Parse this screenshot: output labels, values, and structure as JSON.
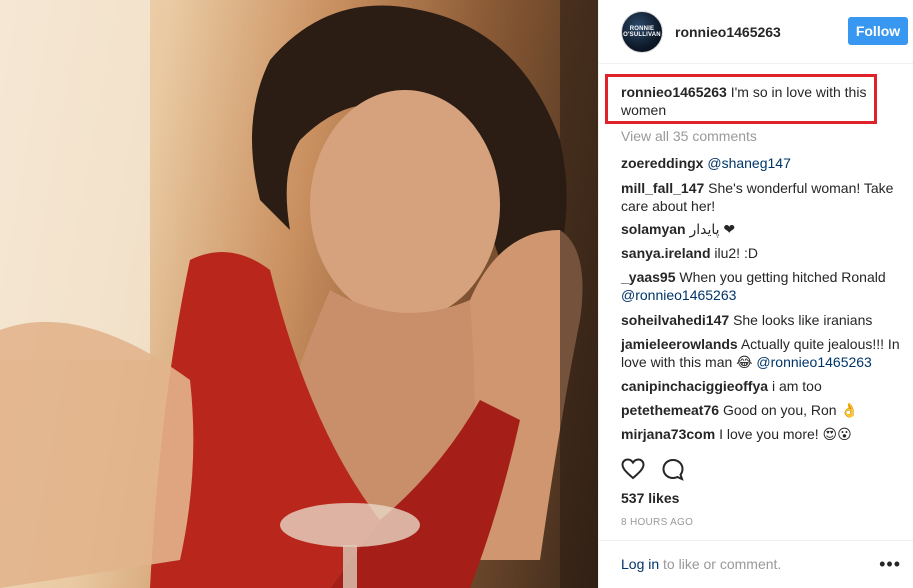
{
  "post": {
    "photo_label": "post-photo",
    "header": {
      "username": "ronnieo1465263",
      "avatar_text_1": "RONNIE",
      "avatar_text_2": "O'SULLIVAN",
      "follow_label": "Follow"
    },
    "caption": {
      "username": "ronnieo1465263",
      "text": "I'm so in love with this women"
    },
    "view_all": "View all 35 comments",
    "comments": [
      {
        "user": "zoereddingx",
        "text": "",
        "mention": "@shaneg147"
      },
      {
        "user": "mill_fall_147",
        "text": "She's wonderful woman! Take care about her!",
        "mention": ""
      },
      {
        "user": "solamyan",
        "text": "پایدار ❤",
        "mention": ""
      },
      {
        "user": "sanya.ireland",
        "text": "ilu2! :D",
        "mention": ""
      },
      {
        "user": "_yaas95",
        "text": "When you getting hitched Ronald",
        "mention": "@ronnieo1465263"
      },
      {
        "user": "soheilvahedi147",
        "text": "She looks like iranians",
        "mention": ""
      },
      {
        "user": "jamieleerowlands",
        "text": "Actually quite jealous!!! In love with this man 😂",
        "mention": "@ronnieo1465263"
      },
      {
        "user": "canipinchaciggieoffya",
        "text": "i am too",
        "mention": ""
      },
      {
        "user": "petethemeat76",
        "text": "Good on you, Ron 👌",
        "mention": ""
      },
      {
        "user": "mirjana73com",
        "text": "I love you more! 😍😮",
        "mention": ""
      }
    ],
    "likes": "537 likes",
    "time": "8 HOURS AGO",
    "login_link": "Log in",
    "login_rest": " to like or comment.",
    "more": "•••"
  },
  "icons": [
    "heart-icon",
    "comment-icon",
    "more-options-icon"
  ],
  "colors": {
    "follow_button": "#3897f0",
    "highlight_box": "#e0222a",
    "mention": "#003569",
    "muted": "#999999"
  }
}
